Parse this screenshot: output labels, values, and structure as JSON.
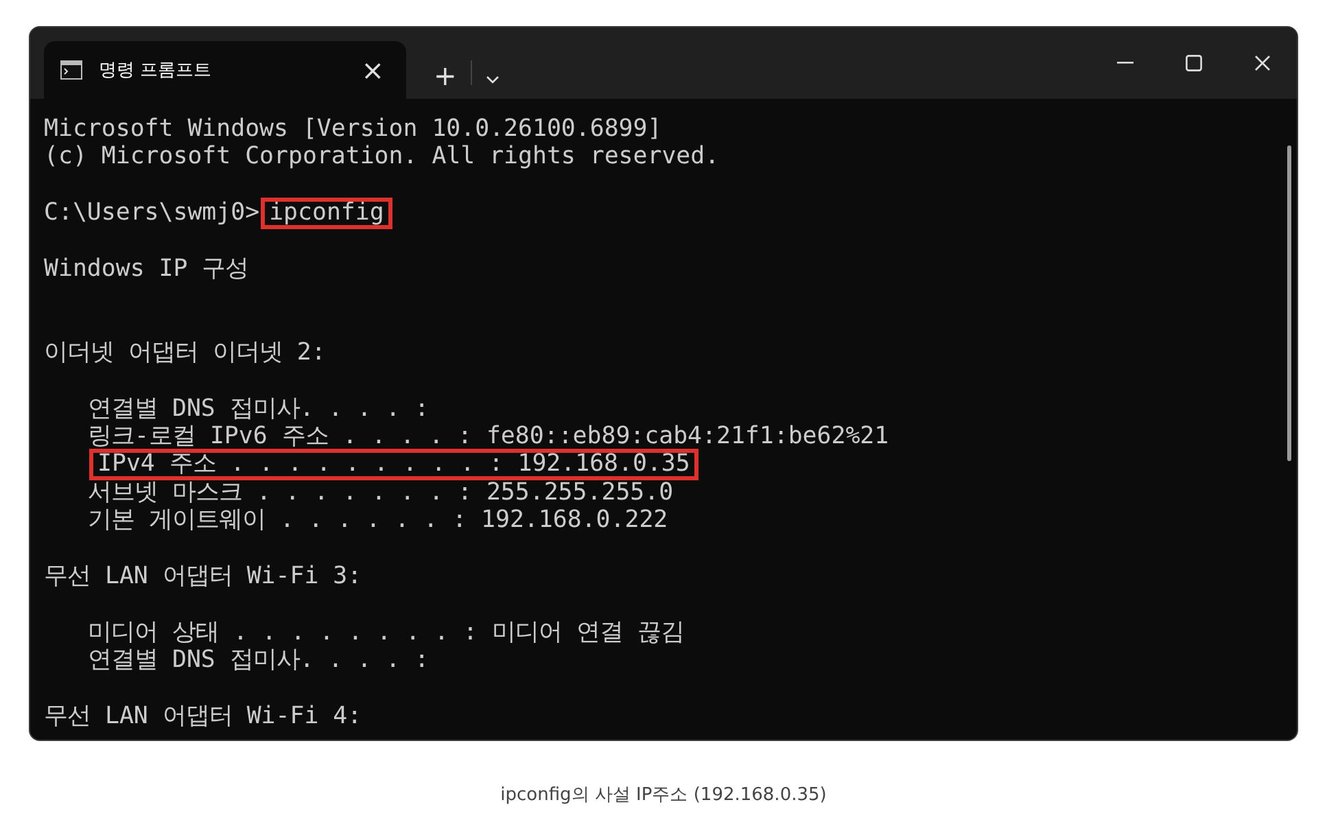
{
  "window": {
    "tab_title": "명령 프롬프트",
    "tab_close": "×",
    "new_tab": "+"
  },
  "terminal": {
    "lines": [
      {
        "kind": "text",
        "segments": [
          {
            "text": "Microsoft Windows [Version 10.0.26100.6899]",
            "highlighted": false
          }
        ]
      },
      {
        "kind": "text",
        "segments": [
          {
            "text": "(c) Microsoft Corporation. All rights reserved.",
            "highlighted": false
          }
        ]
      },
      {
        "kind": "blank"
      },
      {
        "kind": "text",
        "segments": [
          {
            "text": "C:\\Users\\swmj0>",
            "highlighted": false
          },
          {
            "text": "ipconfig",
            "highlighted": true
          }
        ]
      },
      {
        "kind": "blank"
      },
      {
        "kind": "text",
        "segments": [
          {
            "text": "Windows IP 구성",
            "highlighted": false
          }
        ]
      },
      {
        "kind": "blank"
      },
      {
        "kind": "blank"
      },
      {
        "kind": "text",
        "segments": [
          {
            "text": "이더넷 어댑터 이더넷 2:",
            "highlighted": false
          }
        ]
      },
      {
        "kind": "blank"
      },
      {
        "kind": "indented",
        "segments": [
          {
            "text": "연결별 DNS 접미사. . . . :",
            "highlighted": false
          }
        ]
      },
      {
        "kind": "indented",
        "segments": [
          {
            "text": "링크-로컬 IPv6 주소 . . . . : fe80::eb89:cab4:21f1:be62%21",
            "highlighted": false
          }
        ]
      },
      {
        "kind": "indented",
        "segments": [
          {
            "text": "IPv4 주소 . . . . . . . . . : 192.168.0.35",
            "highlighted": true
          }
        ]
      },
      {
        "kind": "indented",
        "segments": [
          {
            "text": "서브넷 마스크 . . . . . . . : 255.255.255.0",
            "highlighted": false
          }
        ]
      },
      {
        "kind": "indented",
        "segments": [
          {
            "text": "기본 게이트웨이 . . . . . . : 192.168.0.222",
            "highlighted": false
          }
        ]
      },
      {
        "kind": "blank"
      },
      {
        "kind": "text",
        "segments": [
          {
            "text": "무선 LAN 어댑터 Wi-Fi 3:",
            "highlighted": false
          }
        ]
      },
      {
        "kind": "blank"
      },
      {
        "kind": "indented",
        "segments": [
          {
            "text": "미디어 상태 . . . . . . . . : 미디어 연결 끊김",
            "highlighted": false
          }
        ]
      },
      {
        "kind": "indented",
        "segments": [
          {
            "text": "연결별 DNS 접미사. . . . :",
            "highlighted": false
          }
        ]
      },
      {
        "kind": "blank"
      },
      {
        "kind": "text",
        "segments": [
          {
            "text": "무선 LAN 어댑터 Wi-Fi 4:",
            "highlighted": false
          }
        ]
      }
    ]
  },
  "caption": "ipconfig의 사설 IP주소 (192.168.0.35)"
}
